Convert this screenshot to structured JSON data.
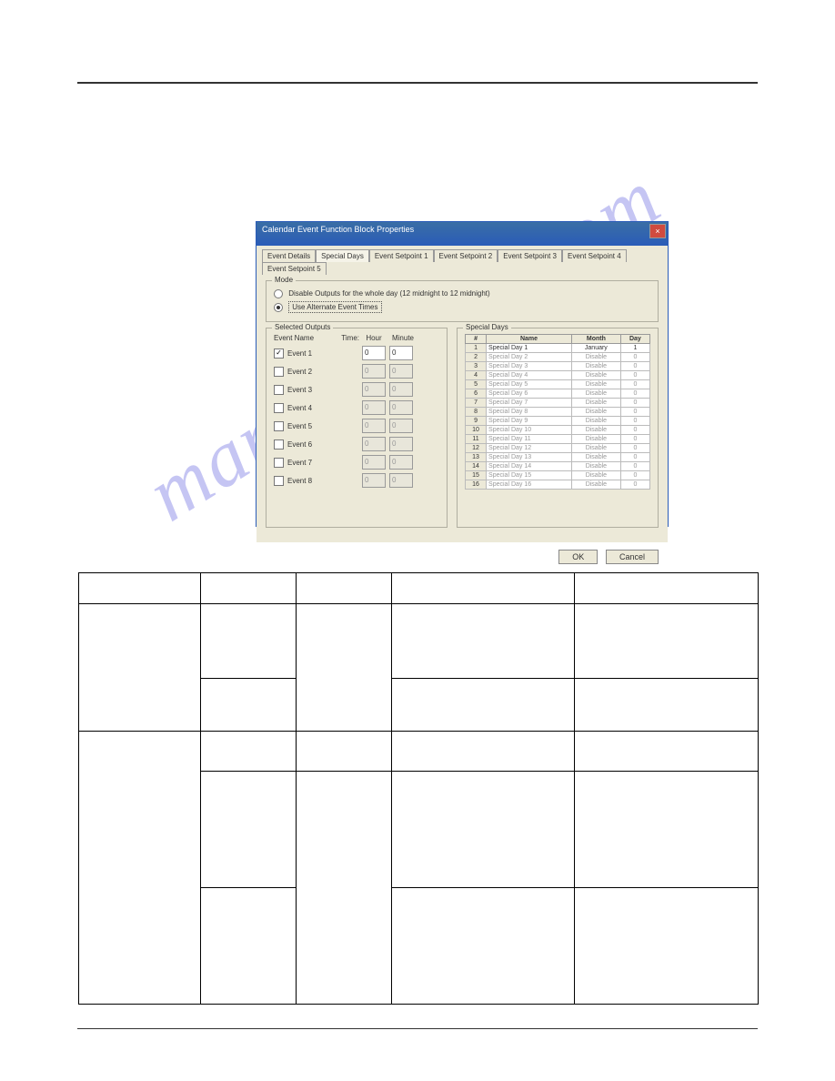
{
  "watermark": "manualshive.com",
  "dialog": {
    "title": "Calendar Event Function Block Properties",
    "tabs": [
      "Event Details",
      "Special Days",
      "Event Setpoint 1",
      "Event Setpoint 2",
      "Event Setpoint 3",
      "Event Setpoint 4",
      "Event Setpoint 5"
    ],
    "mode": {
      "group": "Mode",
      "opt1": "Disable Outputs for the whole day (12 midnight to 12 midnight)",
      "opt2": "Use Alternate Event Times"
    },
    "selected": {
      "group": "Selected Outputs",
      "name_hdr": "Event Name",
      "time_hdr": "Time:",
      "hour_hdr": "Hour",
      "minute_hdr": "Minute",
      "events": [
        {
          "label": "Event 1",
          "checked": true,
          "hour": "0",
          "minute": "0"
        },
        {
          "label": "Event 2",
          "checked": false,
          "hour": "0",
          "minute": "0"
        },
        {
          "label": "Event 3",
          "checked": false,
          "hour": "0",
          "minute": "0"
        },
        {
          "label": "Event 4",
          "checked": false,
          "hour": "0",
          "minute": "0"
        },
        {
          "label": "Event 5",
          "checked": false,
          "hour": "0",
          "minute": "0"
        },
        {
          "label": "Event 6",
          "checked": false,
          "hour": "0",
          "minute": "0"
        },
        {
          "label": "Event 7",
          "checked": false,
          "hour": "0",
          "minute": "0"
        },
        {
          "label": "Event 8",
          "checked": false,
          "hour": "0",
          "minute": "0"
        }
      ]
    },
    "special": {
      "group": "Special Days",
      "cols": {
        "num": "#",
        "name": "Name",
        "month": "Month",
        "day": "Day"
      },
      "rows": [
        {
          "n": "1",
          "name": "Special Day 1",
          "month": "January",
          "day": "1",
          "on": true
        },
        {
          "n": "2",
          "name": "Special Day 2",
          "month": "Disable",
          "day": "0",
          "on": false
        },
        {
          "n": "3",
          "name": "Special Day 3",
          "month": "Disable",
          "day": "0",
          "on": false
        },
        {
          "n": "4",
          "name": "Special Day 4",
          "month": "Disable",
          "day": "0",
          "on": false
        },
        {
          "n": "5",
          "name": "Special Day 5",
          "month": "Disable",
          "day": "0",
          "on": false
        },
        {
          "n": "6",
          "name": "Special Day 6",
          "month": "Disable",
          "day": "0",
          "on": false
        },
        {
          "n": "7",
          "name": "Special Day 7",
          "month": "Disable",
          "day": "0",
          "on": false
        },
        {
          "n": "8",
          "name": "Special Day 8",
          "month": "Disable",
          "day": "0",
          "on": false
        },
        {
          "n": "9",
          "name": "Special Day 9",
          "month": "Disable",
          "day": "0",
          "on": false
        },
        {
          "n": "10",
          "name": "Special Day 10",
          "month": "Disable",
          "day": "0",
          "on": false
        },
        {
          "n": "11",
          "name": "Special Day 11",
          "month": "Disable",
          "day": "0",
          "on": false
        },
        {
          "n": "12",
          "name": "Special Day 12",
          "month": "Disable",
          "day": "0",
          "on": false
        },
        {
          "n": "13",
          "name": "Special Day 13",
          "month": "Disable",
          "day": "0",
          "on": false
        },
        {
          "n": "14",
          "name": "Special Day 14",
          "month": "Disable",
          "day": "0",
          "on": false
        },
        {
          "n": "15",
          "name": "Special Day 15",
          "month": "Disable",
          "day": "0",
          "on": false
        },
        {
          "n": "16",
          "name": "Special Day 16",
          "month": "Disable",
          "day": "0",
          "on": false
        }
      ]
    },
    "buttons": {
      "ok": "OK",
      "cancel": "Cancel"
    }
  }
}
